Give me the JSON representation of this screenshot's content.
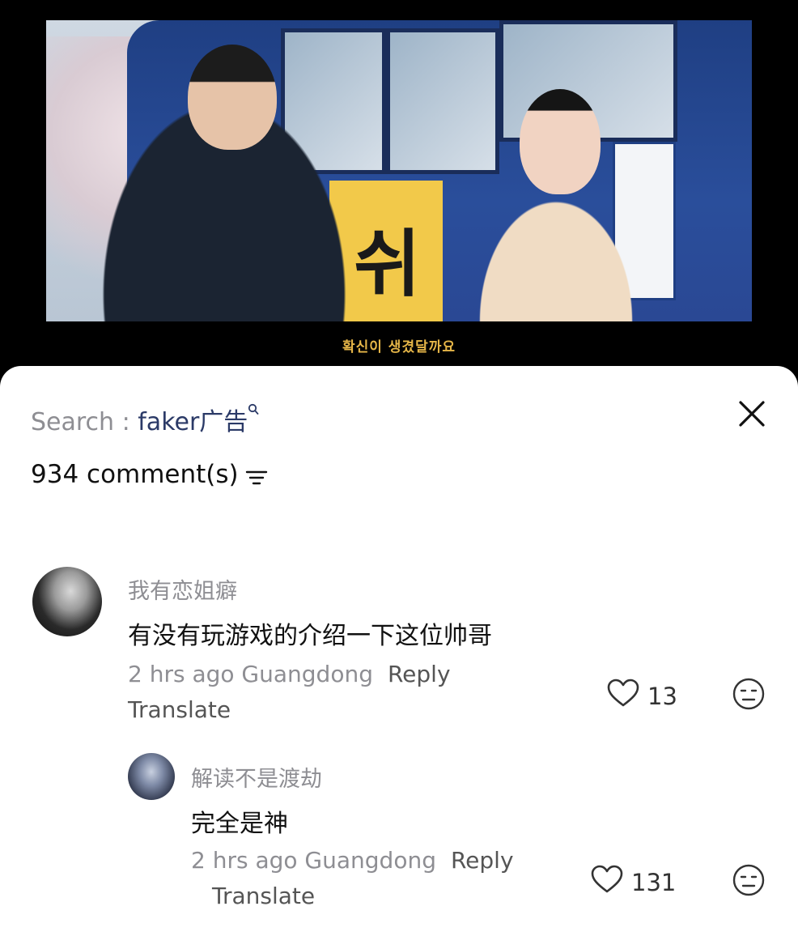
{
  "video": {
    "subtitle": "확신이 생겼달까요",
    "bus_sign_letter": "쉬"
  },
  "search": {
    "label": "Search : ",
    "keyword": "faker广告"
  },
  "comments_header": {
    "count_label": "934 comment(s)"
  },
  "comments": [
    {
      "username": "我有恋姐癖",
      "text": "有没有玩游戏的介绍一下这位帅哥",
      "meta": "2 hrs ago Guangdong",
      "reply_label": "Reply",
      "translate_label": "Translate",
      "likes": "13"
    },
    {
      "username": "解读不是渡劫",
      "text": "完全是神",
      "meta": "2 hrs ago Guangdong",
      "reply_label": "Reply",
      "translate_label": "Translate",
      "likes": "131"
    }
  ]
}
